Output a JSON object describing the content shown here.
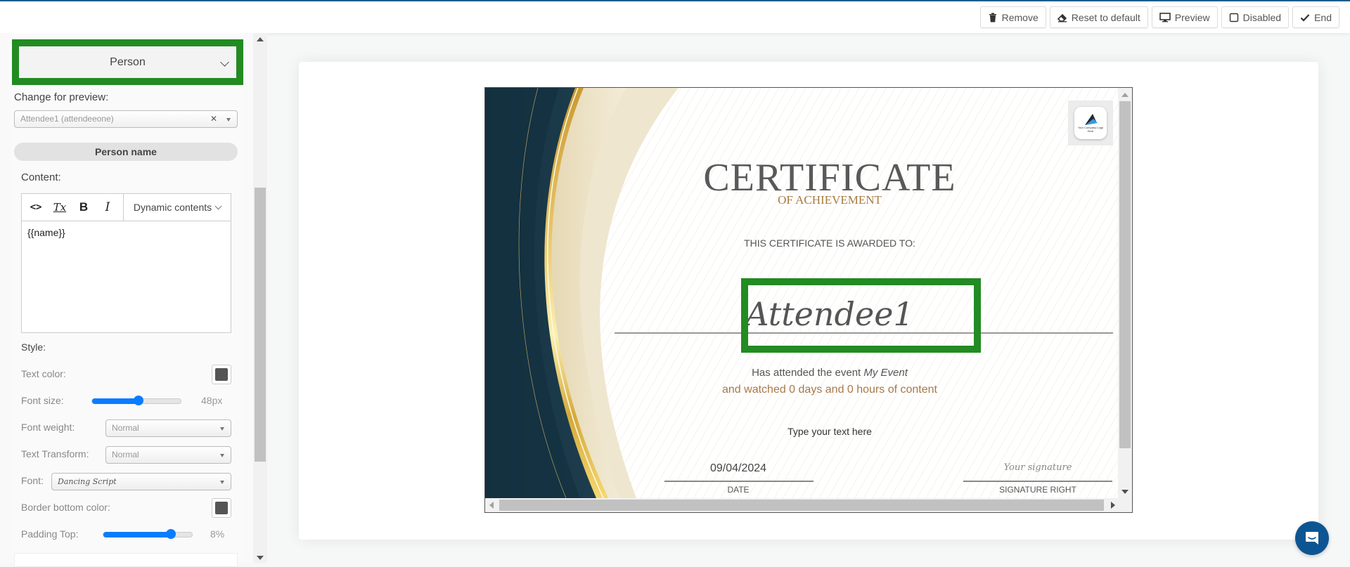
{
  "toolbar": {
    "buttons": [
      {
        "label": "Remove",
        "icon": "trash-icon"
      },
      {
        "label": "Reset to default",
        "icon": "eraser-icon"
      },
      {
        "label": "Preview",
        "icon": "monitor-icon"
      },
      {
        "label": "Disabled",
        "icon": "checkbox-icon"
      },
      {
        "label": "End",
        "icon": "check-icon"
      }
    ]
  },
  "sidebar": {
    "section_title": "Person",
    "change_preview_label": "Change for preview:",
    "preview_select": {
      "value": "Attendee1 (attendeeone)"
    },
    "element_pill": "Person name",
    "content_label": "Content:",
    "editor": {
      "tools": [
        {
          "name": "code-icon",
          "glyph": "<>"
        },
        {
          "name": "clear-format-icon",
          "glyph": "Tx"
        },
        {
          "name": "bold-icon",
          "glyph": "B"
        },
        {
          "name": "italic-icon",
          "glyph": "I"
        }
      ],
      "dynamic_contents_label": "Dynamic contents",
      "body": "{{name}}"
    },
    "style_label": "Style:",
    "style": {
      "text_color_label": "Text color:",
      "text_color": "#555555",
      "font_size_label": "Font size:",
      "font_size_value": "48px",
      "font_size_fraction": 0.52,
      "font_weight_label": "Font weight:",
      "font_weight_value": "Normal",
      "text_transform_label": "Text Transform:",
      "text_transform_value": "Normal",
      "font_label": "Font:",
      "font_value": "Dancing Script",
      "border_bottom_color_label": "Border bottom color:",
      "border_bottom_color": "#555555",
      "padding_top_label": "Padding Top:",
      "padding_top_value": "8%",
      "padding_top_fraction": 0.76
    }
  },
  "certificate": {
    "title": "CERTIFICATE",
    "subtitle": "OF ACHIEVEMENT",
    "awarded_to": "THIS CERTIFICATE IS AWARDED TO:",
    "name": "Attendee1",
    "attended_prefix": "Has attended the event ",
    "event_name": "My Event",
    "watched": "and watched 0 days and 0 hours of content",
    "free_text": "Type your text here",
    "date_value": "09/04/2024",
    "date_label": "DATE",
    "signature_value": "Your signature",
    "signature_label": "SIGNATURE RIGHT",
    "logo_text": "Your Company Logo Here"
  },
  "colors": {
    "highlight": "#228b22",
    "accent_blue": "#0a7cff",
    "chat_button": "#0d5592",
    "cert_navy": "#13303f",
    "cert_gold": "#d4a93c"
  }
}
